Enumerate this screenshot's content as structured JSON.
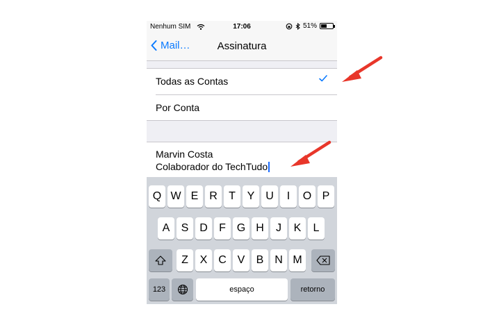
{
  "status_bar": {
    "carrier": "Nenhum SIM",
    "time": "17:06",
    "battery_percent": "51%",
    "battery_level": 0.51
  },
  "nav": {
    "back_label": "Mail…",
    "title": "Assinatura"
  },
  "options": [
    {
      "label": "Todas as Contas",
      "selected": true
    },
    {
      "label": "Por Conta",
      "selected": false
    }
  ],
  "signature": {
    "line1": "Marvin Costa",
    "line2": "Colaborador do TechTudo"
  },
  "keyboard": {
    "row1": [
      "Q",
      "W",
      "E",
      "R",
      "T",
      "Y",
      "U",
      "I",
      "O",
      "P"
    ],
    "row2": [
      "A",
      "S",
      "D",
      "F",
      "G",
      "H",
      "J",
      "K",
      "L"
    ],
    "row3": [
      "Z",
      "X",
      "C",
      "V",
      "B",
      "N",
      "M"
    ],
    "numbers_key": "123",
    "space_key": "espaço",
    "return_key": "retorno"
  },
  "colors": {
    "accent": "#0a7aff",
    "annotation_arrow": "#e8362a",
    "caret": "#1a6bff"
  }
}
